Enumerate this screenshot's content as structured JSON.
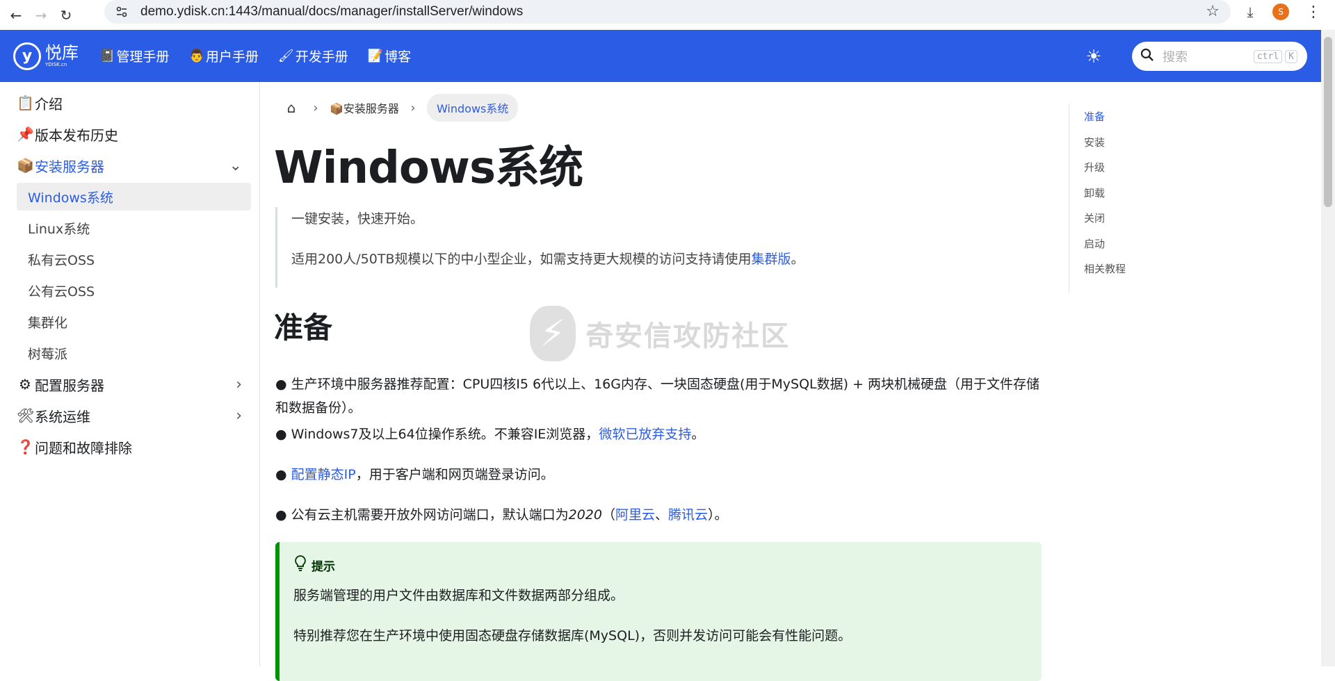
{
  "browser": {
    "url": "demo.ydisk.cn:1443/manual/docs/manager/installServer/windows",
    "profile_initial": "S"
  },
  "header": {
    "logo_text": "悦库",
    "logo_sub": "YDISK.cn",
    "logo_mark": "y",
    "nav": [
      {
        "icon": "📓",
        "label": "管理手册"
      },
      {
        "icon": "👨",
        "label": "用户手册"
      },
      {
        "icon": "🖌",
        "label": "开发手册"
      },
      {
        "icon": "📝",
        "label": "博客"
      }
    ],
    "search_placeholder": "搜索",
    "kbd1": "ctrl",
    "kbd2": "K"
  },
  "sidebar": {
    "items": [
      {
        "icon": "📋",
        "label": "介绍"
      },
      {
        "icon": "📌",
        "label": "版本发布历史"
      },
      {
        "icon": "📦",
        "label": "安装服务器"
      },
      {
        "icon": "⚙",
        "label": "配置服务器"
      },
      {
        "icon": "🛠",
        "label": "系统运维"
      },
      {
        "icon": "❓",
        "label": "问题和故障排除"
      }
    ],
    "subitems": [
      "Windows系统",
      "Linux系统",
      "私有云OSS",
      "公有云OSS",
      "集群化",
      "树莓派"
    ]
  },
  "breadcrumb": {
    "parent": "📦安装服务器",
    "current": "Windows系统"
  },
  "content": {
    "title": "Windows系统",
    "quote1": "一键安装，快速开始。",
    "quote2_pre": "适用200人/50TB规模以下的中小型企业，如需支持更大规模的访问支持请使用",
    "quote2_link": "集群版",
    "quote2_post": "。",
    "h2": "准备",
    "b1": "● 生产环境中服务器推荐配置：CPU四核I5 6代以上、16G内存、一块固态硬盘(用于MySQL数据) + 两块机械硬盘（用于文件存储和数据备份）。",
    "b2_pre": "● Windows7及以上64位操作系统。不兼容IE浏览器，",
    "b2_link": "微软已放弃支持",
    "b2_post": "。",
    "b3_pre": "● ",
    "b3_link": "配置静态IP",
    "b3_post": "，用于客户端和网页端登录访问。",
    "b4_pre": "● 公有云主机需要开放外网访问端口，默认端口为",
    "b4_port": "2020",
    "b4_mid": "（",
    "b4_link1": "阿里云",
    "b4_sep": "、",
    "b4_link2": "腾讯云",
    "b4_post": "）。",
    "tip_title": "提示",
    "tip_p1": "服务端管理的用户文件由数据库和文件数据两部分组成。",
    "tip_p2": "特别推荐您在生产环境中使用固态硬盘存储数据库(MySQL)，否则并发访问可能会有性能问题。"
  },
  "watermark": "奇安信攻防社区",
  "toc": [
    "准备",
    "安装",
    "升级",
    "卸载",
    "关闭",
    "启动",
    "相关教程"
  ]
}
